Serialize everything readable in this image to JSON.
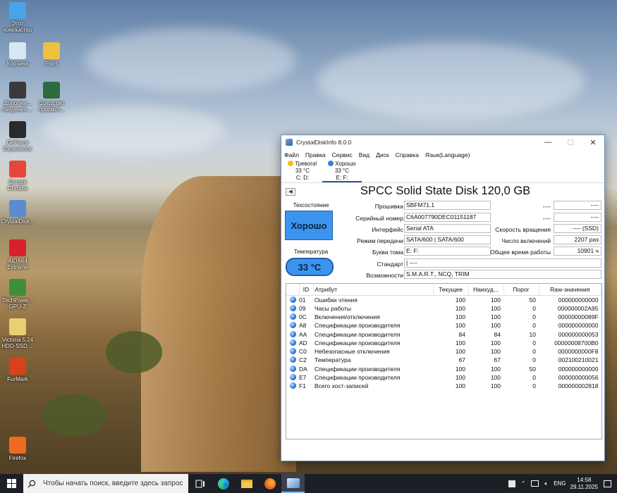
{
  "desktop": {
    "icons": [
      {
        "label": "Этот\nкомпьютер",
        "icon": "this-pc-icon",
        "color": "#4aa3e8"
      },
      {
        "label": "Корзина",
        "icon": "recycle-bin-icon",
        "color": "#d8e6f2"
      },
      {
        "label": "Paint",
        "icon": "paint-icon",
        "color": "#f0c040"
      },
      {
        "label": "Дополни...\nсведения ...",
        "icon": "extra-info-icon",
        "color": "#3a3a3a"
      },
      {
        "label": "Средство\nпросмот...",
        "icon": "viewer-icon",
        "color": "#2d6a3e"
      },
      {
        "label": "GeForce\nExperience",
        "icon": "geforce-icon",
        "color": "#2a2a2a"
      },
      {
        "label": "Google\nChrome",
        "icon": "chrome-icon",
        "color": "#e5483b"
      },
      {
        "label": "CrystalDisk...",
        "icon": "crystaldisk-icon",
        "color": "#5a8ccf"
      },
      {
        "label": "AIDA64\nExtreme",
        "icon": "aida64-icon",
        "color": "#d8202a"
      },
      {
        "label": "TechPowe...\nGPU-Z",
        "icon": "gpuz-icon",
        "color": "#3e8f3a"
      },
      {
        "label": "Victoria 5.24\nHDD-SSD ...",
        "icon": "victoria-icon",
        "color": "#e8d070"
      },
      {
        "label": "FurMark",
        "icon": "furmark-icon",
        "color": "#d8421a"
      },
      {
        "label": "Firefox",
        "icon": "firefox-icon",
        "color": "#ef6a1e"
      }
    ]
  },
  "window": {
    "title": "CrystalDiskInfo 8.0.0",
    "menu": [
      "Файл",
      "Правка",
      "Сервис",
      "Вид",
      "Диск",
      "Справка",
      "Язык(Language)"
    ],
    "disks": [
      {
        "status": "Тревога!",
        "temp": "33 °C",
        "letters": "C: D:",
        "color": "#f1c21b"
      },
      {
        "status": "Хорошо",
        "temp": "33 °C",
        "letters": "E: F:",
        "color": "#3b82d6"
      }
    ],
    "model": "SPCC Solid State Disk 120,0 GB",
    "health_label": "Техсостояние",
    "health_value": "Хорошо",
    "temp_label": "Температура",
    "temp_value": "33 °C",
    "info": {
      "firmware_label": "Прошивка",
      "firmware": "SBFM71.1",
      "serial_label": "Серийный номер",
      "serial": "C6A007790DEC01151187",
      "interface_label": "Интерфейс",
      "interface": "Serial ATA",
      "transfer_label": "Режим передачи",
      "transfer": "SATA/600 | SATA/600",
      "letter_label": "Буква тома",
      "letter": "E: F:",
      "standard_label": "Стандарт",
      "standard": "| ----",
      "features_label": "Возможности",
      "features": "S.M.A.R.T., NCQ, TRIM",
      "r1_label": "----",
      "r1": "----",
      "r2_label": "----",
      "r2": "----",
      "rotation_label": "Скорость вращения",
      "rotation": "---- (SSD)",
      "power_count_label": "Число включений",
      "power_count": "2207 раз",
      "power_hours_label": "Общее время работы",
      "power_hours": "10901 ч"
    },
    "smart_headers": [
      "ID",
      "Атрибут",
      "Текущее",
      "Наихуд...",
      "Порог",
      "Raw-значения"
    ],
    "smart_rows": [
      [
        "01",
        "Ошибки чтения",
        "100",
        "100",
        "50",
        "000000000000"
      ],
      [
        "09",
        "Часы работы",
        "100",
        "100",
        "0",
        "000000002A95"
      ],
      [
        "0C",
        "Включения/отключения",
        "100",
        "100",
        "0",
        "00000000089F"
      ],
      [
        "A8",
        "Спецификации производителя",
        "100",
        "100",
        "0",
        "000000000000"
      ],
      [
        "AA",
        "Спецификации производителя",
        "84",
        "84",
        "10",
        "000000000053"
      ],
      [
        "AD",
        "Спецификации производителя",
        "100",
        "100",
        "0",
        "00000008700B0"
      ],
      [
        "C0",
        "Небезопасные отключения",
        "100",
        "100",
        "0",
        "0000000000F8"
      ],
      [
        "C2",
        "Температура",
        "67",
        "67",
        "0",
        "002100210021"
      ],
      [
        "DA",
        "Спецификации производителя",
        "100",
        "100",
        "50",
        "000000000000"
      ],
      [
        "E7",
        "Спецификации производителя",
        "100",
        "100",
        "0",
        "000000000056"
      ],
      [
        "F1",
        "Всего хост-записей",
        "100",
        "100",
        "0",
        "000000002818"
      ]
    ]
  },
  "taskbar": {
    "search_placeholder": "Чтобы начать поиск, введите здесь запрос",
    "lang": "ENG",
    "time": "14:58",
    "date": "29.11.2025"
  }
}
